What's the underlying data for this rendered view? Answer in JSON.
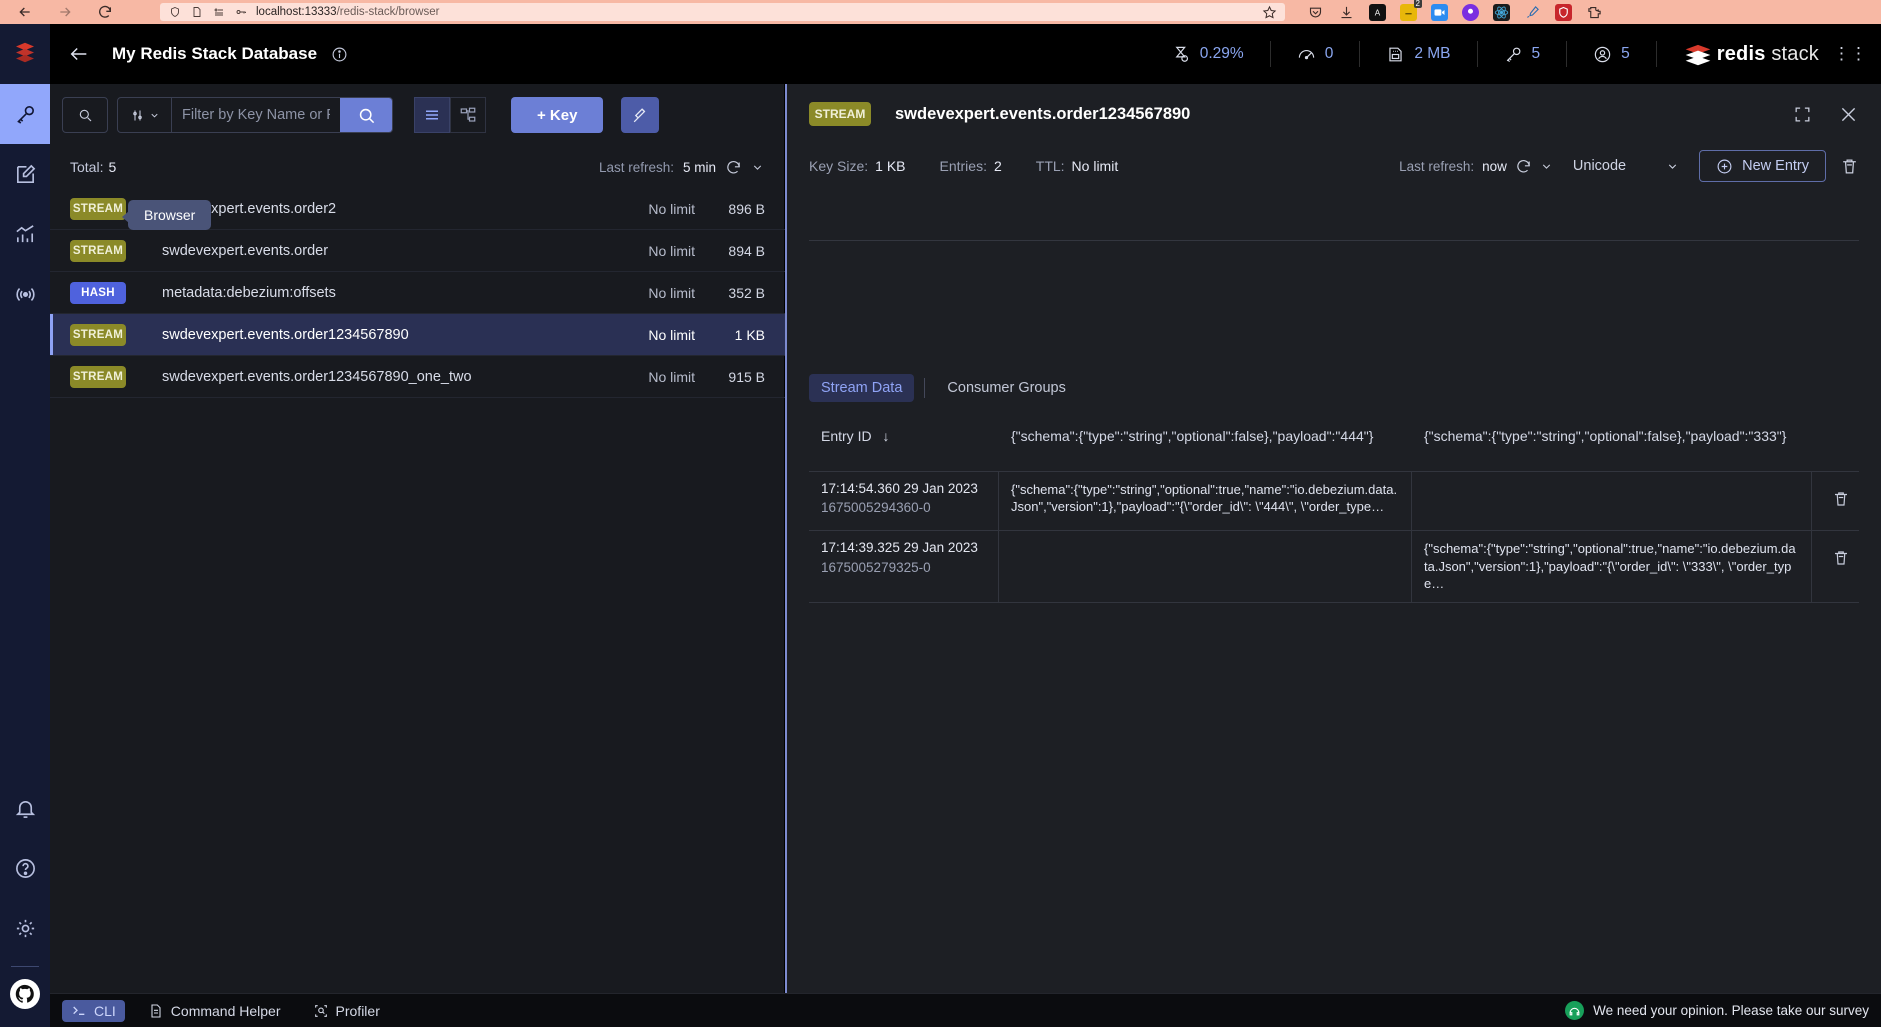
{
  "browser": {
    "url_host": "localhost:13333",
    "url_path": "/redis-stack/browser",
    "extensions_badge": "2"
  },
  "header": {
    "db_title": "My Redis Stack Database",
    "metrics": [
      {
        "icon": "cpu-icon",
        "value": "0.29%"
      },
      {
        "icon": "speedometer-icon",
        "value": "0"
      },
      {
        "icon": "memory-card-icon",
        "value": "2 MB"
      },
      {
        "icon": "key-icon",
        "value": "5"
      },
      {
        "icon": "user-icon",
        "value": "5"
      }
    ],
    "logo_bold": "redis",
    "logo_light": " stack"
  },
  "rail": {
    "tooltip": "Browser",
    "items": [
      {
        "name": "browser",
        "icon": "key-icon"
      },
      {
        "name": "workbench",
        "icon": "edit-square-icon"
      },
      {
        "name": "analysis-tools",
        "icon": "bar-chart-icon"
      },
      {
        "name": "pub-sub",
        "icon": "broadcast-icon"
      }
    ],
    "bottom": [
      {
        "name": "notifications",
        "icon": "bell-icon"
      },
      {
        "name": "help",
        "icon": "question-circle-icon"
      },
      {
        "name": "settings",
        "icon": "gear-icon"
      },
      {
        "name": "github",
        "icon": "github-icon"
      }
    ]
  },
  "keys_panel": {
    "filter_placeholder": "Filter by Key Name or Pattern",
    "filter_value": "",
    "add_key_label": "+ Key",
    "total_label": "Total:",
    "total_value": "5",
    "last_refresh_label": "Last refresh:",
    "last_refresh_value": "5 min",
    "rows": [
      {
        "type": "STREAM",
        "name": "swdevexpert.events.order2",
        "ttl": "No limit",
        "size": "896 B",
        "selected": false
      },
      {
        "type": "STREAM",
        "name": "swdevexpert.events.order",
        "ttl": "No limit",
        "size": "894 B",
        "selected": false
      },
      {
        "type": "HASH",
        "name": "metadata:debezium:offsets",
        "ttl": "No limit",
        "size": "352 B",
        "selected": false
      },
      {
        "type": "STREAM",
        "name": "swdevexpert.events.order1234567890",
        "ttl": "No limit",
        "size": "1 KB",
        "selected": true
      },
      {
        "type": "STREAM",
        "name": "swdevexpert.events.order1234567890_one_two",
        "ttl": "No limit",
        "size": "915 B",
        "selected": false
      }
    ]
  },
  "details": {
    "badge": "STREAM",
    "key_name": "swdevexpert.events.order1234567890",
    "key_size_label": "Key Size:",
    "key_size_value": "1 KB",
    "entries_label": "Entries:",
    "entries_value": "2",
    "ttl_label": "TTL:",
    "ttl_value": "No limit",
    "last_refresh_label": "Last refresh:",
    "last_refresh_value": "now",
    "encoding": "Unicode",
    "new_entry_label": "New Entry",
    "tabs": [
      {
        "label": "Stream Data",
        "active": true
      },
      {
        "label": "Consumer Groups",
        "active": false
      }
    ],
    "table": {
      "columns": [
        "Entry ID",
        "{\"schema\":{\"type\":\"string\",\"optional\":false},\"payload\":\"444\"}",
        "{\"schema\":{\"type\":\"string\",\"optional\":false},\"payload\":\"333\"}"
      ],
      "sort_indicator": "↓",
      "rows": [
        {
          "time": "17:14:54.360 29 Jan 2023",
          "id": "1675005294360-0",
          "field1": "{\"schema\":{\"type\":\"string\",\"optional\":true,\"name\":\"io.debezium.data.Json\",\"version\":1},\"payload\":\"{\\\"order_id\\\": \\\"444\\\", \\\"order_type…",
          "field2": ""
        },
        {
          "time": "17:14:39.325 29 Jan 2023",
          "id": "1675005279325-0",
          "field1": "",
          "field2": "{\"schema\":{\"type\":\"string\",\"optional\":true,\"name\":\"io.debezium.data.Json\",\"version\":1},\"payload\":\"{\\\"order_id\\\": \\\"333\\\", \\\"order_type…"
        }
      ]
    }
  },
  "bottombar": {
    "items": [
      {
        "label": "CLI",
        "icon": "terminal-icon",
        "active": true
      },
      {
        "label": "Command Helper",
        "icon": "document-icon",
        "active": false
      },
      {
        "label": "Profiler",
        "icon": "magnifier-frame-icon",
        "active": false
      }
    ],
    "survey_text": "We need your opinion. Please take our survey"
  },
  "colors": {
    "accent": "#6c7fd6",
    "stream_badge": "#8b8a28",
    "hash_badge": "#4f62dd",
    "selected_row": "#2a3054"
  }
}
